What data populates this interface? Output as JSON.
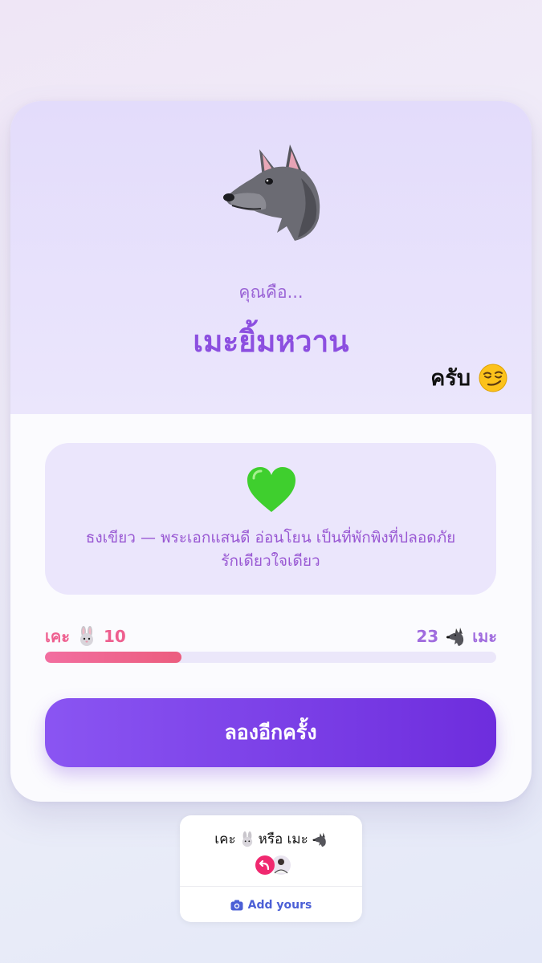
{
  "result": {
    "subtitle": "คุณคือ...",
    "title": "เมะยิ้มหวาน",
    "sticker_text": "ครับ",
    "icon": "wolf-icon"
  },
  "info": {
    "icon": "green-heart-icon",
    "line1": "ธงเขียว — พระเอกแสนดี อ่อนโยน เป็นที่พักพิงที่ปลอดภัย",
    "line2": "รักเดียวใจเดียว"
  },
  "score": {
    "left_label": "เคะ",
    "left_value": "10",
    "right_value": "23",
    "right_label": "เมะ",
    "fill_fraction": 0.303,
    "colors": {
      "left": "#ee5f8f",
      "right": "#a06cde"
    }
  },
  "button": {
    "label": "ลองอีกครั้ง"
  },
  "add_yours": {
    "prompt_a": "เคะ",
    "prompt_b": "หรือ เมะ",
    "label": "Add yours"
  },
  "colors": {
    "accent": "#8c4fe0",
    "button": "#7b3ee8"
  }
}
